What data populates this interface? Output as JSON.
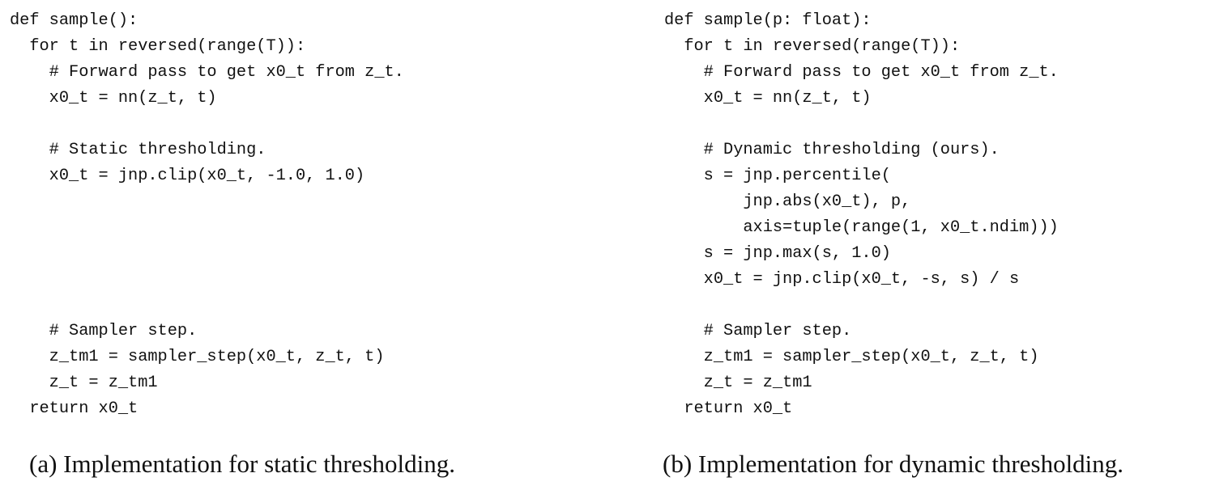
{
  "panel_a": {
    "code_lines": [
      "def sample():",
      "  for t in reversed(range(T)):",
      "    # Forward pass to get x0_t from z_t.",
      "    x0_t = nn(z_t, t)",
      "",
      "    # Static thresholding.",
      "    x0_t = jnp.clip(x0_t, -1.0, 1.0)",
      "",
      "",
      "",
      "",
      "",
      "    # Sampler step.",
      "    z_tm1 = sampler_step(x0_t, z_t, t)",
      "    z_t = z_tm1",
      "  return x0_t"
    ],
    "caption": "(a) Implementation for static thresholding."
  },
  "panel_b": {
    "code_lines": [
      "def sample(p: float):",
      "  for t in reversed(range(T)):",
      "    # Forward pass to get x0_t from z_t.",
      "    x0_t = nn(z_t, t)",
      "",
      "    # Dynamic thresholding (ours).",
      "    s = jnp.percentile(",
      "        jnp.abs(x0_t), p,",
      "        axis=tuple(range(1, x0_t.ndim)))",
      "    s = jnp.max(s, 1.0)",
      "    x0_t = jnp.clip(x0_t, -s, s) / s",
      "",
      "    # Sampler step.",
      "    z_tm1 = sampler_step(x0_t, z_t, t)",
      "    z_t = z_tm1",
      "  return x0_t"
    ],
    "caption": "(b) Implementation for dynamic thresholding."
  }
}
